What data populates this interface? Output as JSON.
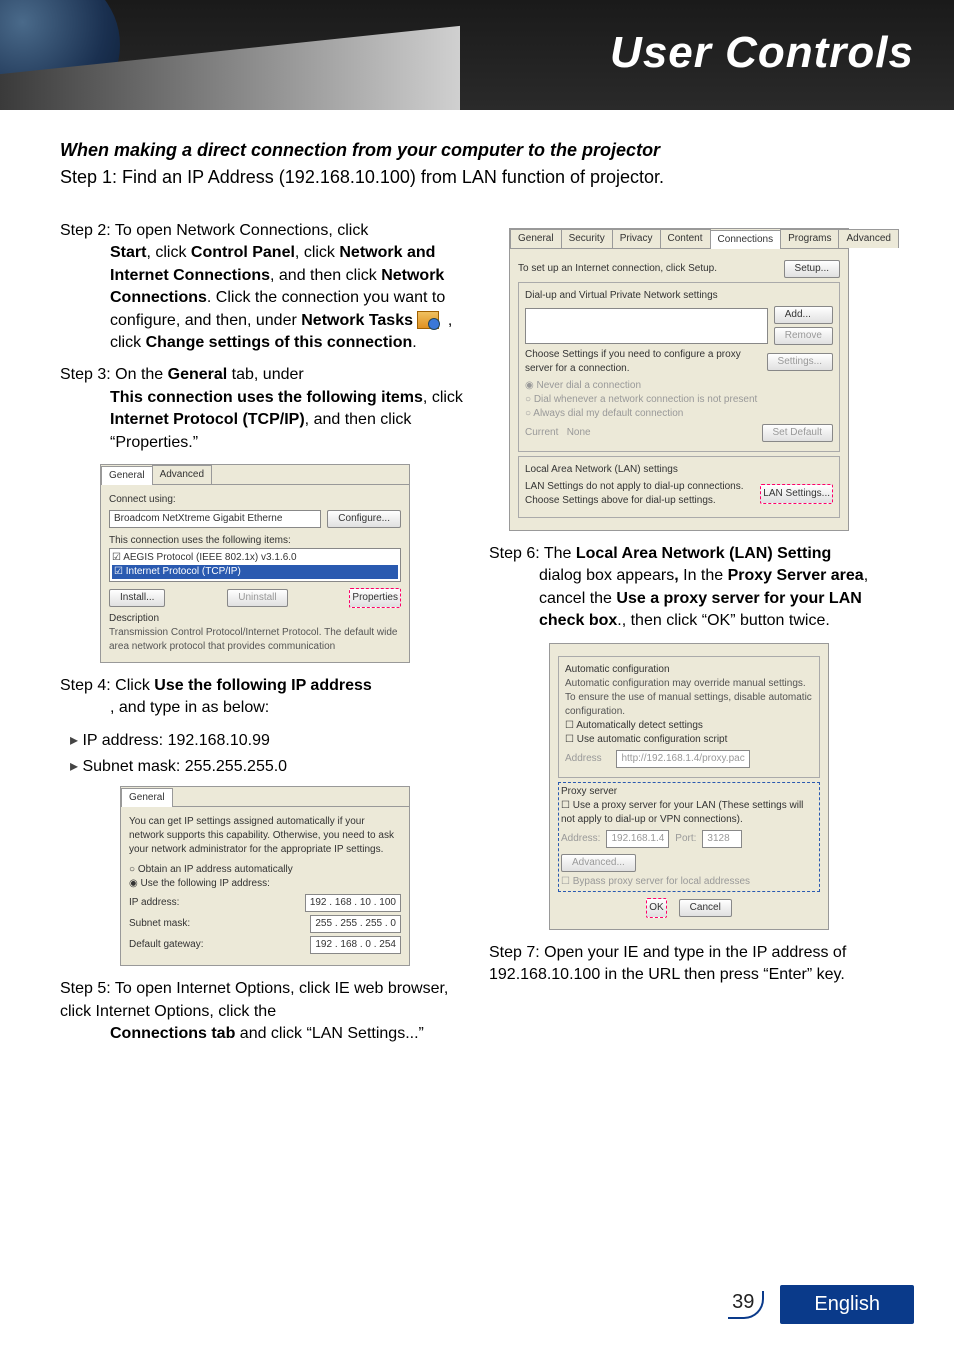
{
  "header": {
    "title": "User Controls"
  },
  "intro": {
    "bold": "When making a direct connection from your computer to the projector",
    "line": "Step 1: Find an IP Address (192.168.10.100) from LAN function of projector."
  },
  "left": {
    "step2": {
      "lead": "Step 2: To open Network Connections, click ",
      "b1": "Start",
      "t1": ", click ",
      "b2": "Control Panel",
      "t2": ", click ",
      "b3": "Network and Internet Connections",
      "t3": ", and then click ",
      "b4": "Network Connections",
      "t4": ". Click the connection you want to configure, and then, under ",
      "b5": "Network Tasks",
      "t5": " ",
      "t6": " , click ",
      "b6": "Change settings of this connection",
      "t7": "."
    },
    "step3": {
      "lead": "Step 3: On the ",
      "b1": "General",
      "t1": " tab, under ",
      "b2": "This connection uses the following items",
      "t2": ", click ",
      "b3": "Internet Protocol (TCP/IP)",
      "t3": ", and then click “Properties.”"
    },
    "shot3": {
      "tab_general": "General",
      "tab_advanced": "Advanced",
      "connect_using": "Connect using:",
      "adapter": "Broadcom NetXtreme Gigabit Etherne",
      "configure": "Configure...",
      "uses": "This connection uses the following items:",
      "item1": "AEGIS Protocol (IEEE 802.1x) v3.1.6.0",
      "item2": "Internet Protocol (TCP/IP)",
      "install": "Install...",
      "uninstall": "Uninstall",
      "properties": "Properties",
      "desc_label": "Description",
      "desc_text": "Transmission Control Protocol/Internet Protocol. The default wide area network protocol that provides communication"
    },
    "step4": {
      "lead": "Step 4: Click ",
      "b1": "Use the following IP address",
      "t1": ", and type in as below:"
    },
    "bullet_ip": "IP address: 192.168.10.99",
    "bullet_mask": "Subnet mask: 255.255.255.0",
    "shot4": {
      "tab_general": "General",
      "text": "You can get IP settings assigned automatically if your network supports this capability. Otherwise, you need to ask your network administrator for the appropriate IP settings.",
      "opt_auto": "Obtain an IP address automatically",
      "opt_use": "Use the following IP address:",
      "ip_label": "IP address:",
      "ip_val": "192 . 168 .  10 . 100",
      "mask_label": "Subnet mask:",
      "mask_val": "255 . 255 . 255 .  0",
      "gw_label": "Default gateway:",
      "gw_val": "192 . 168 .  0 . 254"
    },
    "step5": {
      "lead": "Step 5: To open Internet Options, click IE web browser, click Internet Options, click the ",
      "b1": "Connections tab",
      "t1": " and click “LAN Settings...”"
    }
  },
  "right": {
    "shot5": {
      "tabs": [
        "General",
        "Security",
        "Privacy",
        "Content",
        "Connections",
        "Programs",
        "Advanced"
      ],
      "setup_text": "To set up an Internet connection, click Setup.",
      "setup_btn": "Setup...",
      "dialup_label": "Dial-up and Virtual Private Network settings",
      "add": "Add...",
      "remove": "Remove",
      "choose": "Choose Settings if you need to configure a proxy server for a connection.",
      "settings": "Settings...",
      "r1": "Never dial a connection",
      "r2": "Dial whenever a network connection is not present",
      "r3": "Always dial my default connection",
      "current": "Current",
      "none": "None",
      "setdef": "Set Default",
      "lan_group": "Local Area Network (LAN) settings",
      "lan_text": "LAN Settings do not apply to dial-up connections. Choose Settings above for dial-up settings.",
      "lan_btn": "LAN Settings..."
    },
    "step6": {
      "lead": "Step 6: The ",
      "b1": "Local Area Network (LAN) Setting",
      "t1": " dialog box appears",
      "b1a": ",",
      "t1a": " In the ",
      "b2": "Proxy Server area",
      "t2": ", cancel the ",
      "b3": "Use a proxy server for your LAN check box",
      "t3": "., then click “OK” button twice."
    },
    "shot6": {
      "ac_label": "Automatic configuration",
      "ac_text": "Automatic configuration may override manual settings. To ensure the use of manual settings, disable automatic configuration.",
      "c1": "Automatically detect settings",
      "c2": "Use automatic configuration script",
      "addr_l": "Address",
      "addr_v": "http://192.168.1.4/proxy.pac",
      "ps_label": "Proxy server",
      "ps_c": "Use a proxy server for your LAN (These settings will not apply to dial-up or VPN connections).",
      "ps_addr_l": "Address:",
      "ps_addr_v": "192.168.1.4",
      "ps_port_l": "Port:",
      "ps_port_v": "3128",
      "adv": "Advanced...",
      "bypass": "Bypass proxy server for local addresses",
      "ok": "OK",
      "cancel": "Cancel"
    },
    "step7": "Step 7: Open your IE and type in the IP address of 192.168.10.100 in the URL then press “Enter” key."
  },
  "footer": {
    "page": "39",
    "lang": "English"
  }
}
